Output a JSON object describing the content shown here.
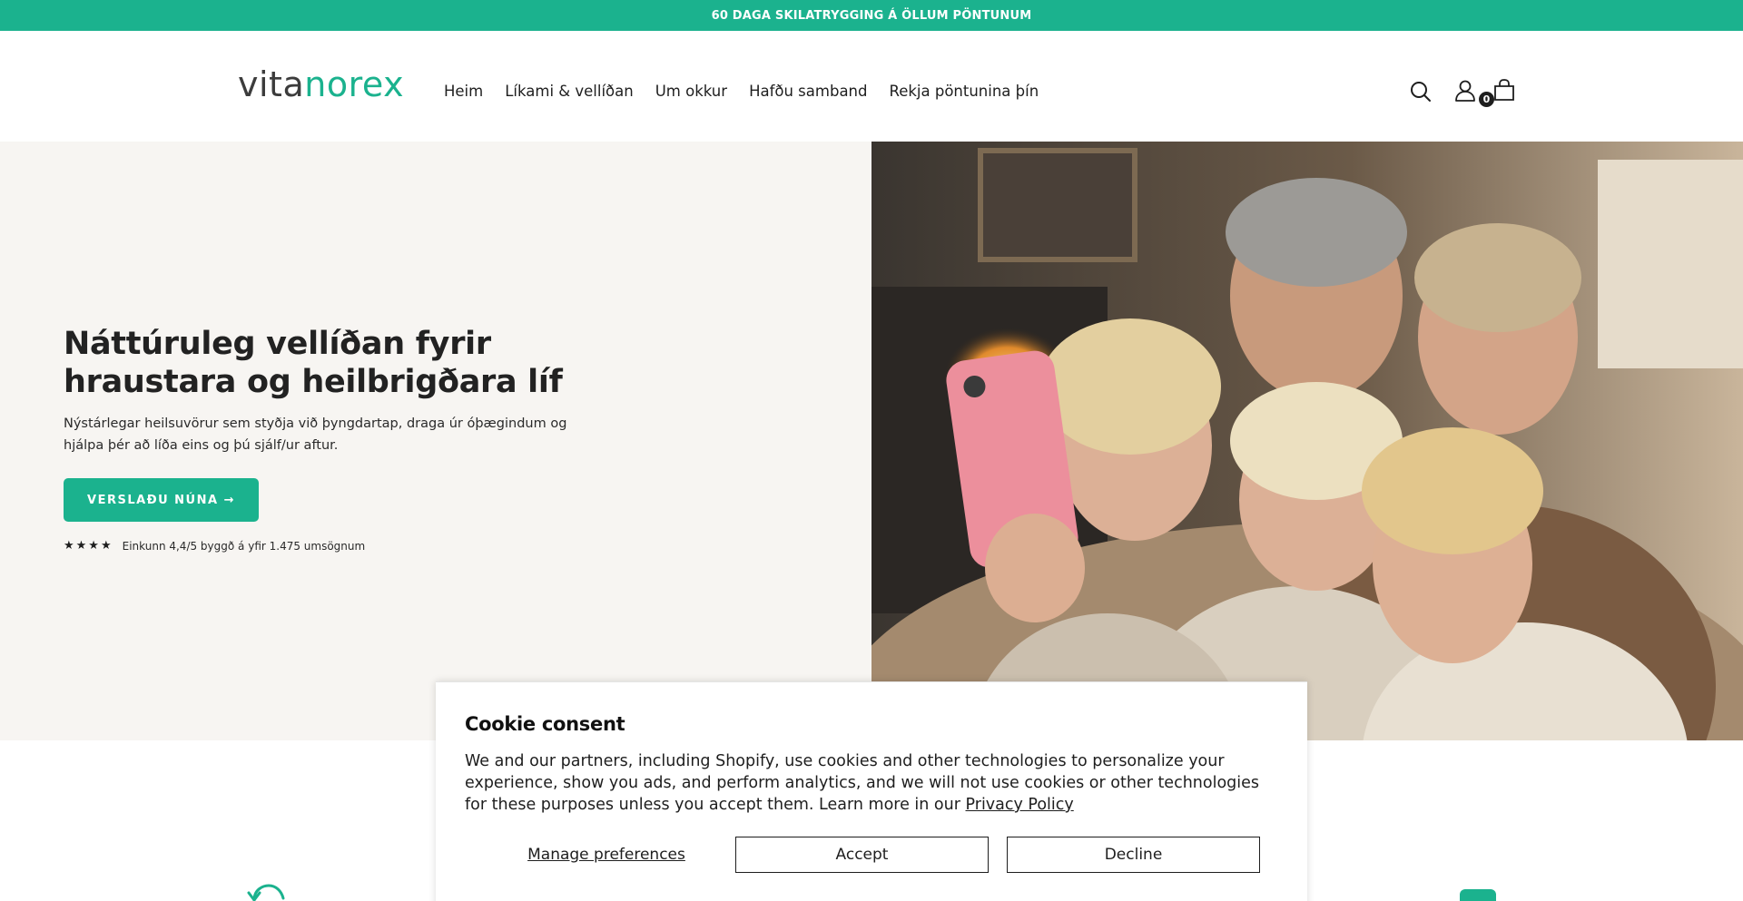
{
  "announcement": {
    "text": "60 DAGA SKILATRYGGING Á ÖLLUM PÖNTUNUM"
  },
  "header": {
    "logo": {
      "part1": "vita",
      "part2": "norex"
    },
    "nav": [
      {
        "label": "Heim"
      },
      {
        "label": "Líkami & vellíðan"
      },
      {
        "label": "Um okkur"
      },
      {
        "label": "Hafðu samband"
      },
      {
        "label": "Rekja pöntunina þín"
      }
    ],
    "icons": [
      "search-icon",
      "account-icon",
      "cart-icon"
    ],
    "cart_count": "0"
  },
  "hero": {
    "title": "Náttúruleg vellíðan fyrir hraustara og heilbrigðara líf",
    "subtitle": "Nýstárlegar heilsuvörur sem styðja við þyngdartap, draga úr óþægindum og hjálpa þér að líða eins og þú sjálf/ur aftur.",
    "cta_label": "VERSLAÐU NÚNA →",
    "rating_stars": "★★★★",
    "rating_text": "Einkunn 4,4/5 byggð á yfir 1.475 umsögnum"
  },
  "cookie": {
    "title": "Cookie consent",
    "body": "We and our partners, including Shopify, use cookies and other technologies to personalize your experience, show you ads, and perform analytics, and we will not use cookies or other technologies for these purposes unless you accept them. Learn more in our ",
    "privacy_link": "Privacy Policy",
    "manage_label": "Manage preferences",
    "accept_label": "Accept",
    "decline_label": "Decline"
  },
  "colors": {
    "accent": "#1bb28e",
    "hero_bg": "#f7f5f2",
    "text": "#1e1e1e"
  }
}
